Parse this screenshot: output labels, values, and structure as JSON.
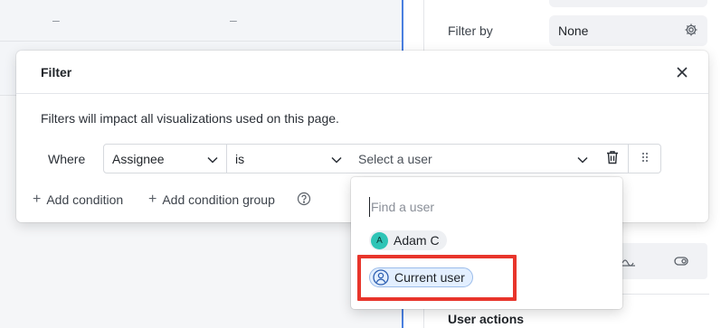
{
  "background": {
    "dashes": [
      "–",
      "–"
    ],
    "filter_by": {
      "label": "Filter by",
      "value": "None"
    },
    "user_actions": "User actions"
  },
  "modal": {
    "title": "Filter",
    "description": "Filters will impact all visualizations used on this page.",
    "condition": {
      "where_label": "Where",
      "field": "Assignee",
      "operator": "is",
      "value_placeholder": "Select a user"
    },
    "add_condition": "Add condition",
    "add_condition_group": "Add condition group"
  },
  "dropdown": {
    "search_placeholder": "Find a user",
    "users": [
      {
        "initial": "A",
        "name": "Adam C",
        "avatar_color": "#2ec4b6"
      },
      {
        "name": "Current user",
        "icon": "person-icon"
      }
    ]
  },
  "colors": {
    "highlight": "#e8352b",
    "selection_border": "#4a7fe0",
    "current_user_chip": "#e3efff"
  }
}
